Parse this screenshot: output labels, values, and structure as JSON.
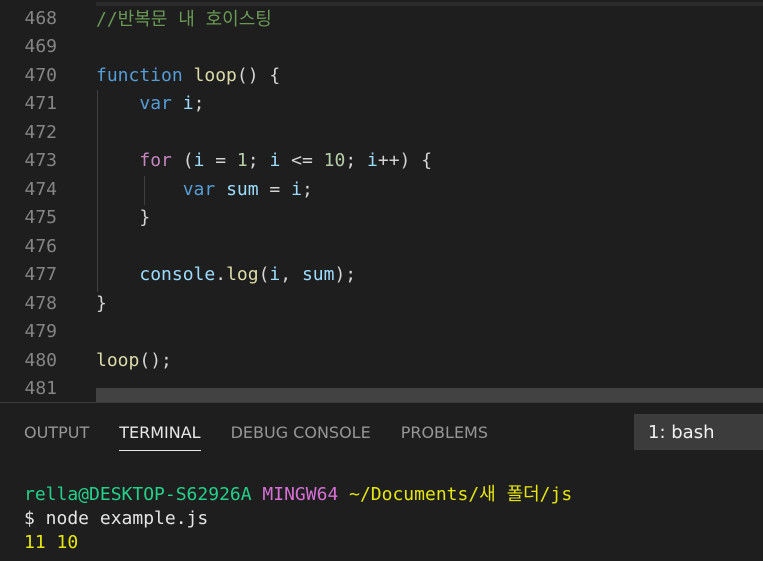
{
  "editor": {
    "lines": [
      {
        "num": "468",
        "tokens": [
          {
            "t": "//반복문 내 호이스팅",
            "c": "comment"
          }
        ]
      },
      {
        "num": "469",
        "tokens": []
      },
      {
        "num": "470",
        "tokens": [
          {
            "t": "function",
            "c": "keyword"
          },
          {
            "t": " ",
            "c": "punct"
          },
          {
            "t": "loop",
            "c": "func"
          },
          {
            "t": "() {",
            "c": "punct"
          }
        ]
      },
      {
        "num": "471",
        "tokens": [
          {
            "t": "    ",
            "c": "punct"
          },
          {
            "t": "var",
            "c": "keyword"
          },
          {
            "t": " ",
            "c": "punct"
          },
          {
            "t": "i",
            "c": "var"
          },
          {
            "t": ";",
            "c": "punct"
          }
        ]
      },
      {
        "num": "472",
        "tokens": []
      },
      {
        "num": "473",
        "tokens": [
          {
            "t": "    ",
            "c": "punct"
          },
          {
            "t": "for",
            "c": "ctrl"
          },
          {
            "t": " (",
            "c": "punct"
          },
          {
            "t": "i",
            "c": "var"
          },
          {
            "t": " = ",
            "c": "op"
          },
          {
            "t": "1",
            "c": "num"
          },
          {
            "t": "; ",
            "c": "punct"
          },
          {
            "t": "i",
            "c": "var"
          },
          {
            "t": " <= ",
            "c": "op"
          },
          {
            "t": "10",
            "c": "num"
          },
          {
            "t": "; ",
            "c": "punct"
          },
          {
            "t": "i",
            "c": "var"
          },
          {
            "t": "++) {",
            "c": "punct"
          }
        ]
      },
      {
        "num": "474",
        "tokens": [
          {
            "t": "        ",
            "c": "punct"
          },
          {
            "t": "var",
            "c": "keyword"
          },
          {
            "t": " ",
            "c": "punct"
          },
          {
            "t": "sum",
            "c": "var"
          },
          {
            "t": " = ",
            "c": "op"
          },
          {
            "t": "i",
            "c": "var"
          },
          {
            "t": ";",
            "c": "punct"
          }
        ]
      },
      {
        "num": "475",
        "tokens": [
          {
            "t": "    }",
            "c": "punct"
          }
        ]
      },
      {
        "num": "476",
        "tokens": []
      },
      {
        "num": "477",
        "tokens": [
          {
            "t": "    ",
            "c": "punct"
          },
          {
            "t": "console",
            "c": "var"
          },
          {
            "t": ".",
            "c": "punct"
          },
          {
            "t": "log",
            "c": "func"
          },
          {
            "t": "(",
            "c": "punct"
          },
          {
            "t": "i",
            "c": "var"
          },
          {
            "t": ", ",
            "c": "punct"
          },
          {
            "t": "sum",
            "c": "var"
          },
          {
            "t": ");",
            "c": "punct"
          }
        ]
      },
      {
        "num": "478",
        "tokens": [
          {
            "t": "}",
            "c": "punct"
          }
        ]
      },
      {
        "num": "479",
        "tokens": []
      },
      {
        "num": "480",
        "tokens": [
          {
            "t": "loop",
            "c": "func"
          },
          {
            "t": "();",
            "c": "punct"
          }
        ]
      },
      {
        "num": "481",
        "tokens": []
      }
    ]
  },
  "panel": {
    "tabs": [
      {
        "label": "OUTPUT",
        "active": false
      },
      {
        "label": "TERMINAL",
        "active": true
      },
      {
        "label": "DEBUG CONSOLE",
        "active": false
      },
      {
        "label": "PROBLEMS",
        "active": false
      }
    ],
    "terminal_selector": "1: bash"
  },
  "terminal": {
    "user": "rella@DESKTOP-S62926A",
    "env": "MINGW64",
    "path": "~/Documents/새 폴더/js",
    "command": "$ node example.js",
    "output": "11 10"
  },
  "colors": {
    "background": "#1e1e1e",
    "keyword": "#569cd6",
    "function": "#dcdcaa",
    "variable": "#9cdcfe",
    "number": "#b5cea8",
    "comment": "#6a9955",
    "control": "#c586c0"
  }
}
